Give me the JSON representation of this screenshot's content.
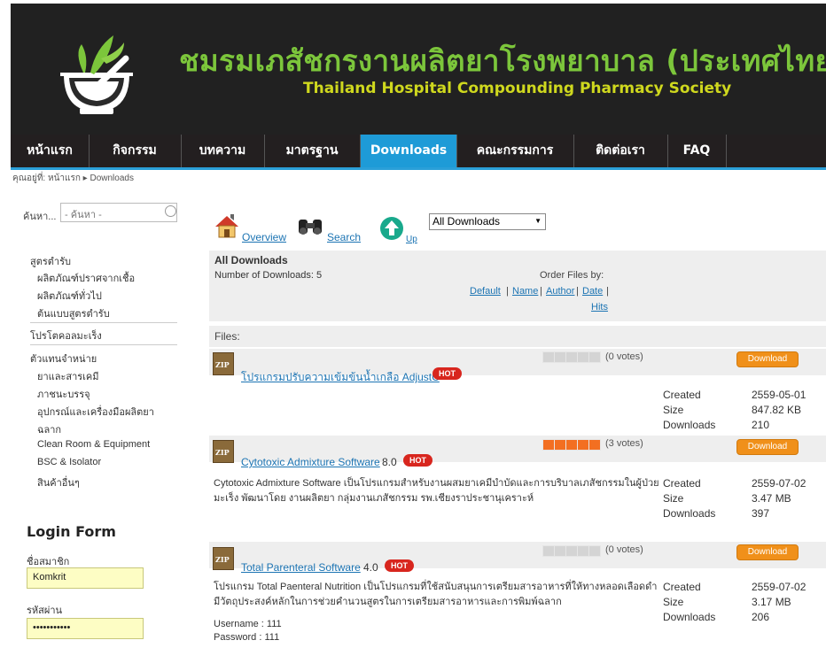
{
  "site": {
    "title_th": "ชมรมเภสัชกรงานผลิตยาโรงพยาบาล (ประเทศไทย)",
    "title_en": "Thailand Hospital Compounding Pharmacy Society"
  },
  "nav": [
    "หน้าแรก",
    "กิจกรรม",
    "บทความ",
    "มาตรฐาน",
    "Downloads",
    "คณะกรรมการ",
    "ติดต่อเรา",
    "FAQ"
  ],
  "breadcrumb": "คุณอยู่ที่: หน้าแรก ▸ Downloads",
  "sidebar": {
    "search_label": "ค้นหา...",
    "search_placeholder": "- ค้นหา -",
    "menu": [
      "สูตรตำรับ",
      "ผลิตภัณฑ์ปราศจากเชื้อ",
      "ผลิตภัณฑ์ทั่วไป",
      "ต้นแบบสูตรตำรับ",
      "โปรโตคอลมะเร็ง",
      "ตัวแทนจำหน่าย",
      "ยาและสารเคมี",
      "ภาชนะบรรจุ",
      "อุปกรณ์และเครื่องมือผลิตยา",
      "ฉลาก",
      "Clean Room & Equipment",
      "BSC & Isolator",
      "สินค้าอื่นๆ"
    ],
    "login_title": "Login Form",
    "username_label": "ชื่อสมาชิก",
    "username_value": "Komkrit",
    "password_label": "รหัสผ่าน",
    "password_value": "•••••••••••"
  },
  "toolbar": {
    "overview": "Overview",
    "search": "Search",
    "up": "Up",
    "select_value": "All Downloads"
  },
  "category": {
    "title": "All Downloads",
    "count": "Number of Downloads: 5",
    "order_label": "Order Files by:",
    "order_default": "Default",
    "order_name": "Name",
    "order_author": "Author",
    "order_date": "Date",
    "order_hits": "Hits",
    "files_label": "Files:"
  },
  "files": [
    {
      "name": "โปรแกรมปรับความเข้มข้นน้ำเกลือ AdjustC",
      "version": "",
      "hot": "HOT",
      "votes": "(0 votes)",
      "rating": 0,
      "button": "Download",
      "description": "",
      "created_k": "Created",
      "created": "2559-05-01",
      "size_k": "Size",
      "size": "847.82 KB",
      "downloads_k": "Downloads",
      "downloads": "210"
    },
    {
      "name": "Cytotoxic Admixture Software",
      "version": "8.0",
      "hot": "HOT",
      "votes": "(3 votes)",
      "rating": 5,
      "button": "Download",
      "description": "Cytotoxic Admixture Software เป็นโปรแกรมสำหรับงานผสมยาเคมีบำบัดและการบริบาลเภสัชกรรมในผู้ป่วยมะเร็ง พัฒนาโดย งานผลิตยา กลุ่มงานเภสัชกรรม รพ.เชียงราประชานุเคราะห์",
      "created_k": "Created",
      "created": "2559-07-02",
      "size_k": "Size",
      "size": "3.47 MB",
      "downloads_k": "Downloads",
      "downloads": "397"
    },
    {
      "name": "Total Parenteral Software",
      "version": "4.0",
      "hot": "HOT",
      "votes": "(0 votes)",
      "rating": 0,
      "button": "Download",
      "description": "โปรแกรม Total Paenteral Nutrition เป็นโปรแกรมที่ใช้สนับสนุนการเตรียมสารอาหารที่ให้ทางหลอดเลือดดำ มีวัตถุประสงค์หลักในการช่วยคำนวนสูตรในการเตรียมสารอาหารและการพิมพ์ฉลาก",
      "created_k": "Created",
      "created": "2559-07-02",
      "size_k": "Size",
      "size": "3.17 MB",
      "downloads_k": "Downloads",
      "downloads": "206",
      "username": "Username : 111",
      "password": "Password : 111"
    }
  ],
  "colors": {
    "banner": "#212121",
    "nav_active": "#1e9bd7",
    "title_th": "#7cc63b",
    "title_en": "#cfd81e",
    "hot": "#d8261e",
    "download_btn": "#f0901a",
    "star_on": "#f36f21"
  }
}
